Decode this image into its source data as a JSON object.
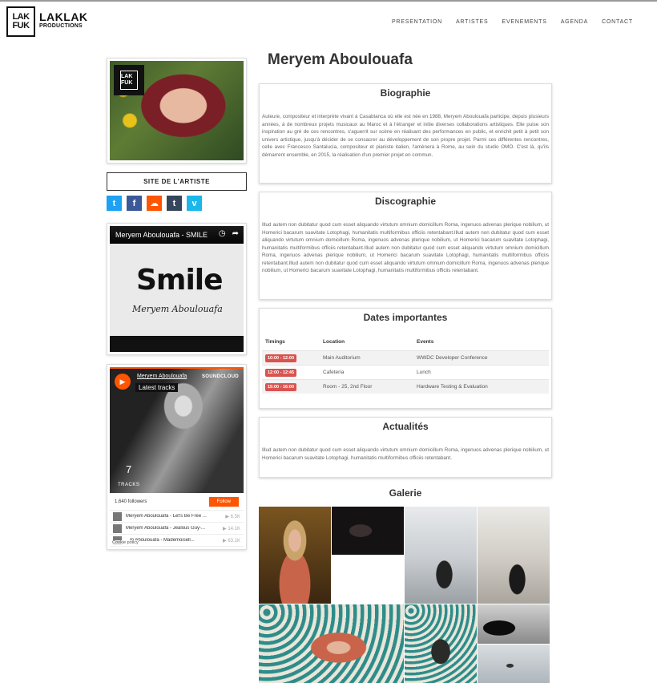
{
  "brand": {
    "name": "LAKLAK",
    "sub": "PRODUCTIONS",
    "mark": [
      "LA",
      "K",
      "FU",
      "K"
    ]
  },
  "nav": [
    "PRESENTATION",
    "ARTISTES",
    "EVENEMENTS",
    "AGENDA",
    "CONTACT"
  ],
  "artist": {
    "name": "Meryem Aboulouafa"
  },
  "sidebar": {
    "site_button": "SITE DE L'ARTISTE",
    "social": [
      {
        "icon": "twitter-icon",
        "glyph": "t",
        "color": "#1da1f2"
      },
      {
        "icon": "facebook-icon",
        "glyph": "f",
        "color": "#3b5998"
      },
      {
        "icon": "soundcloud-icon",
        "glyph": "☁",
        "color": "#f50"
      },
      {
        "icon": "tumblr-icon",
        "glyph": "t",
        "color": "#35465c"
      },
      {
        "icon": "vimeo-icon",
        "glyph": "v",
        "color": "#1ab7ea"
      }
    ],
    "video": {
      "title": "Meryem Aboulouafa - SMILE",
      "art_title": "Smile",
      "art_sub": "Meryem Aboulouafa"
    },
    "soundcloud": {
      "artist": "Meryem Aboulouafa",
      "latest": "Latest tracks",
      "brand": "SOUNDCLOUD",
      "count": "7",
      "count_label": "TRACKS",
      "followers": "1,640 followers",
      "follow": "Follow",
      "tracks": [
        {
          "name": "Meryem Aboulouafa - Let's Be Free ...",
          "plays": "▶ 6.5K"
        },
        {
          "name": "Meryem Aboulouafa - Jealous Guy-...",
          "plays": "▶ 14.1K"
        },
        {
          "name": "...m Aboulouafa - Mademoisell...",
          "plays": "▶ 63.1K"
        }
      ],
      "cookie": "Cookie policy"
    }
  },
  "bio": {
    "title": "Biographie",
    "text": "Auteure, compositeur et interprète vivant à Casablanca où elle est née en 1988, Meryem Aboulouafa participe, depuis plusieurs années, à de nombreux projets musicaux au Maroc et à l'étranger et initie diverses collaborations artistiques. Elle puise son inspiration au gré de ces rencontres, s'aguerrit sur scène en réalisant des performances en public, et enrichit petit à petit son univers artistique, jusqu'à décider de se consacrer au développement de son propre projet. Parmi ces différentes rencontres, celle avec Francesco Santalucia, compositeur et pianiste italien, l'amènera à Rome, au sein du studio OMO. C'est là, qu'ils démarrent ensemble, en 2015, la réalisation d'un premier projet en commun."
  },
  "disco": {
    "title": "Discographie",
    "text": "Illud autem non dubitatur quod cum esset aliquando virtutum omnium domicillum Roma, ingenuos advenas plerique nobilium, ut Homerici bacarum suavitate Lotophagi, humanitatis multiformibus officiis retentabant.Illud autem non dubitatur quod cum esset aliquando virtutum omnium domicillum Roma, ingenuos advenas plerique nobilium, ut Homerici bacarum suavitate Lotophagi, humanitatis multiformibus officiis retentabant.Illud autem non dubitatur quod cum esset aliquando virtutum omnium domicillum Roma, ingenuos advenas plerique nobilium, ut Homerici bacarum suavitate Lotophagi, humanitatis multiformibus officiis retentabant.Illud autem non dubitatur quod cum esset aliquando virtutum omnium domicillum Roma, ingenuos advenas plerique nobilium, ut Homerici bacarum suavitate Lotophagi, humanitatis multiformibus officiis retentabant."
  },
  "dates": {
    "title": "Dates importantes",
    "headers": [
      "Timings",
      "Location",
      "Events"
    ],
    "rows": [
      {
        "time": "10:00 - 12:00",
        "location": "Main Auditorium",
        "event": "WWDC Developer Conference"
      },
      {
        "time": "12:00 - 12:45",
        "location": "Cafeteria",
        "event": "Lunch"
      },
      {
        "time": "15:00 - 16:00",
        "location": "Room - 25, 2nd Floor",
        "event": "Hardware Testing & Evaluation"
      }
    ]
  },
  "news": {
    "title": "Actualités",
    "text": "Illud autem non dubitatur quod cum esset aliquando virtutum omnium domicillum Roma, ingenuos advenas plerique nobilium, ut Homerici bacarum suavitate Lotophagi, humanitatis multiformibus officiis retentabant."
  },
  "gallery": {
    "title": "Galerie"
  },
  "colors": {
    "accent_red": "#d9534f",
    "soundcloud": "#ff5500"
  }
}
